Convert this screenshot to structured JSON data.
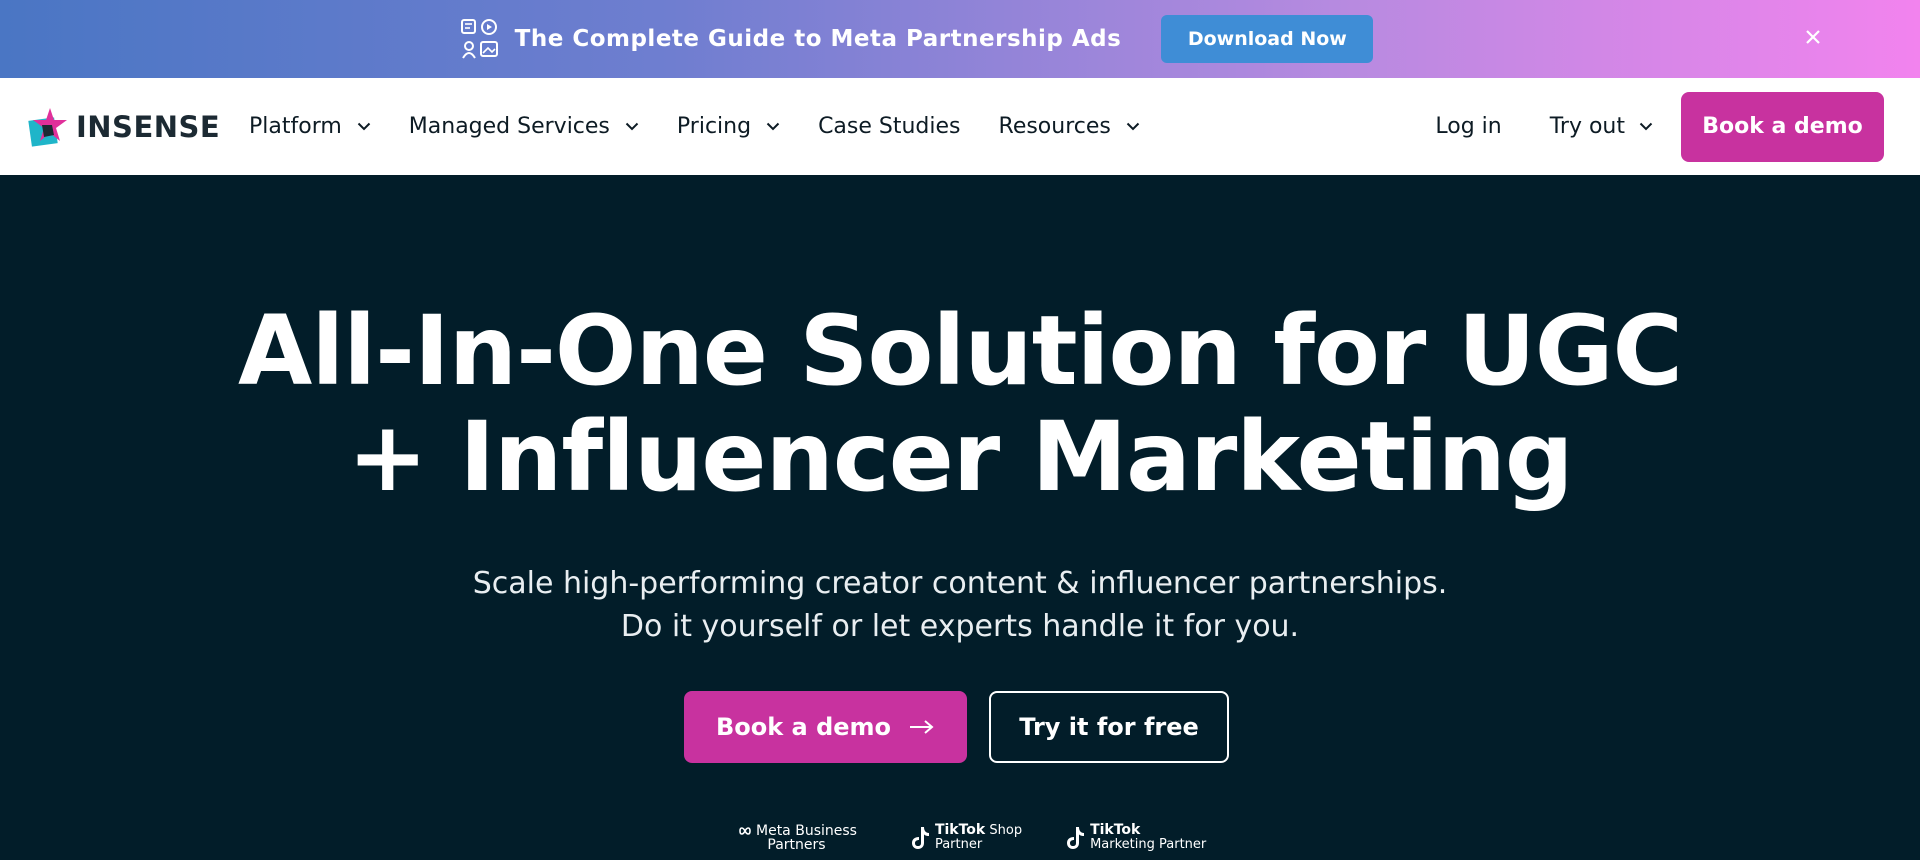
{
  "promo": {
    "text": "The Complete Guide to Meta Partnership Ads",
    "button_label": "Download Now"
  },
  "nav": {
    "logo_text": "INSENSE",
    "items": [
      {
        "label": "Platform",
        "has_dropdown": true
      },
      {
        "label": "Managed Services",
        "has_dropdown": true
      },
      {
        "label": "Pricing",
        "has_dropdown": true
      },
      {
        "label": "Case Studies",
        "has_dropdown": false
      },
      {
        "label": "Resources",
        "has_dropdown": true
      }
    ],
    "login_label": "Log in",
    "tryout_label": "Try out",
    "demo_label": "Book a demo"
  },
  "hero": {
    "title_line1": "All-In-One Solution for UGC",
    "title_line2": "+ Influencer Marketing",
    "subtitle_line1": "Scale high-performing creator content & influencer partnerships.",
    "subtitle_line2": "Do it yourself or let experts handle it for you.",
    "cta_demo_label": "Book a demo",
    "cta_free_label": "Try it for free"
  },
  "partners": {
    "meta_line1": "Meta Business",
    "meta_line2": "Partners",
    "tiktok_shop_brand": "TikTok",
    "tiktok_shop_suffix": "Shop",
    "tiktok_shop_line2": "Partner",
    "tiktok_marketing_brand": "TikTok",
    "tiktok_marketing_line2": "Marketing Partner"
  },
  "colors": {
    "brand_pink": "#c8329f",
    "hero_bg": "#021d29",
    "promo_button": "#3f8dd6",
    "logo_teal": "#1fb5c9"
  }
}
